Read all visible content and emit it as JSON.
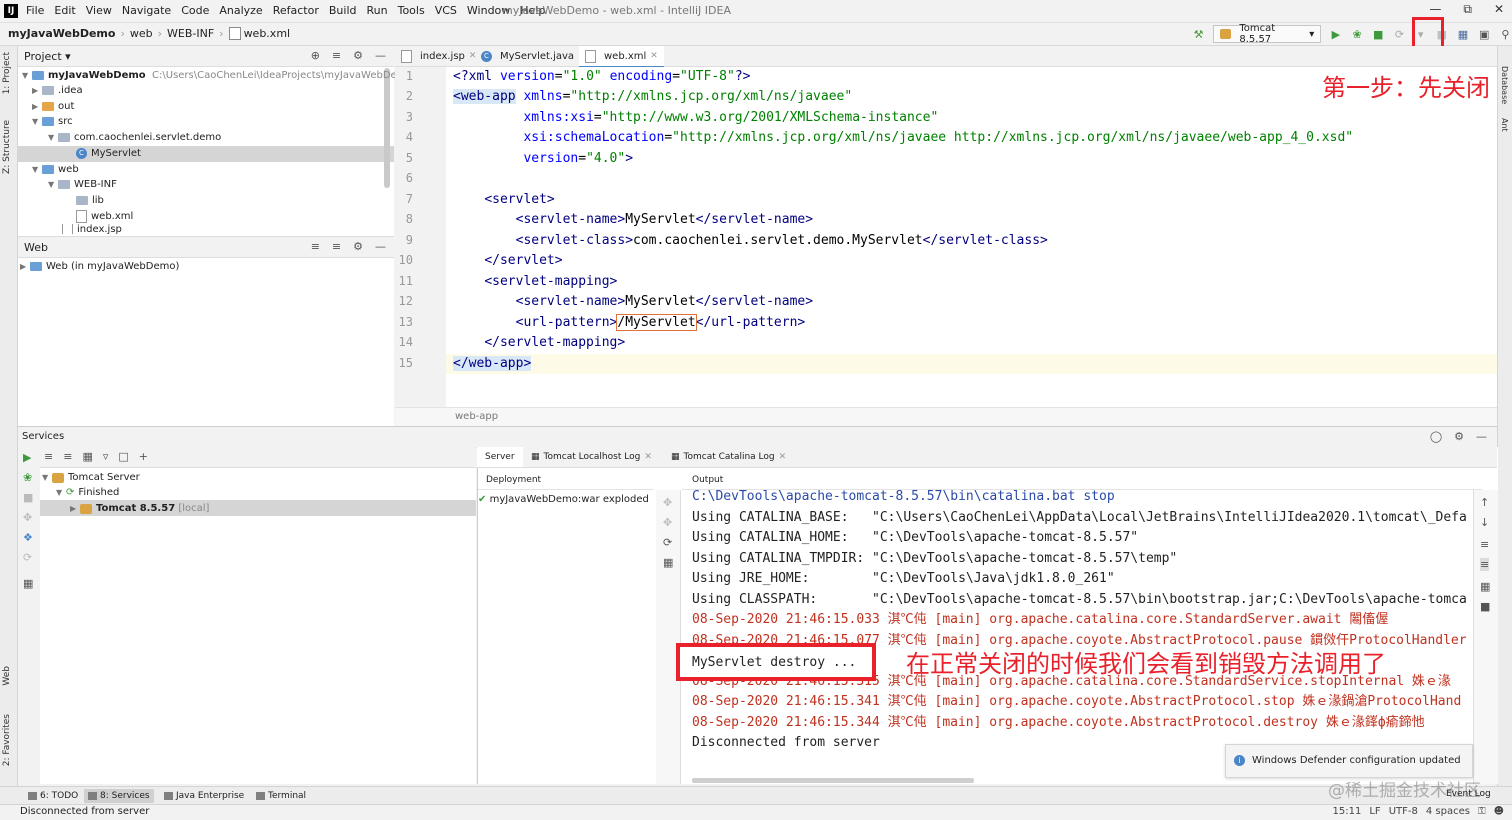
{
  "menu": {
    "items": [
      "File",
      "Edit",
      "View",
      "Navigate",
      "Code",
      "Analyze",
      "Refactor",
      "Build",
      "Run",
      "Tools",
      "VCS",
      "Window",
      "Help"
    ],
    "window_title": "myJavaWebDemo - web.xml - IntelliJ IDEA"
  },
  "breadcrumb": [
    "myJavaWebDemo",
    "web",
    "WEB-INF",
    "web.xml"
  ],
  "run_config": "Tomcat 8.5.57",
  "project_panel": {
    "title": "Project",
    "root_name": "myJavaWebDemo",
    "root_path": "C:\\Users\\CaoChenLei\\IdeaProjects\\myJavaWebDemo",
    "items": [
      ".idea",
      "out",
      "src",
      "com.caochenlei.servlet.demo",
      "MyServlet",
      "web",
      "WEB-INF",
      "lib",
      "web.xml",
      "index.jsp"
    ]
  },
  "web_panel": {
    "title": "Web",
    "item": "Web (in myJavaWebDemo)"
  },
  "left_strip": {
    "project": "1: Project",
    "structure": "Z: Structure",
    "web": "Web",
    "favorites": "2: Favorites"
  },
  "right_strip": {
    "database": "Database",
    "ant": "Ant"
  },
  "editor": {
    "tabs": [
      "index.jsp",
      "MyServlet.java",
      "web.xml"
    ],
    "line_numbers": [
      "1",
      "2",
      "3",
      "4",
      "5",
      "6",
      "7",
      "8",
      "9",
      "10",
      "11",
      "12",
      "13",
      "14",
      "15"
    ],
    "lines": [
      {
        "num": "1",
        "parts": [
          [
            "tag",
            "<?xml "
          ],
          [
            "attr",
            "version"
          ],
          [
            "txt",
            "="
          ],
          [
            "str",
            "\"1.0\""
          ],
          [
            "txt",
            " "
          ],
          [
            "attr",
            "encoding"
          ],
          [
            "txt",
            "="
          ],
          [
            "str",
            "\"UTF-8\""
          ],
          [
            "tag",
            "?>"
          ]
        ]
      },
      {
        "num": "2",
        "parts": [
          [
            "tag hl",
            "<web-app"
          ],
          [
            "txt",
            " "
          ],
          [
            "attr",
            "xmlns"
          ],
          [
            "txt",
            "="
          ],
          [
            "str",
            "\"http://xmlns.jcp.org/xml/ns/javaee\""
          ]
        ]
      },
      {
        "num": "3",
        "parts": [
          [
            "txt",
            "         "
          ],
          [
            "attr",
            "xmlns:xsi"
          ],
          [
            "txt",
            "="
          ],
          [
            "str",
            "\"http://www.w3.org/2001/XMLSchema-instance\""
          ]
        ]
      },
      {
        "num": "4",
        "parts": [
          [
            "txt",
            "         "
          ],
          [
            "attr",
            "xsi:schemaLocation"
          ],
          [
            "txt",
            "="
          ],
          [
            "str",
            "\"http://xmlns.jcp.org/xml/ns/javaee http://xmlns.jcp.org/xml/ns/javaee/web-app_4_0.xsd\""
          ]
        ]
      },
      {
        "num": "5",
        "parts": [
          [
            "txt",
            "         "
          ],
          [
            "attr",
            "version"
          ],
          [
            "txt",
            "="
          ],
          [
            "str",
            "\"4.0\""
          ],
          [
            "tag",
            ">"
          ]
        ]
      },
      {
        "num": "6",
        "parts": []
      },
      {
        "num": "7",
        "parts": [
          [
            "txt",
            "    "
          ],
          [
            "tag",
            "<servlet>"
          ]
        ]
      },
      {
        "num": "8",
        "parts": [
          [
            "txt",
            "        "
          ],
          [
            "tag",
            "<servlet-name>"
          ],
          [
            "txt",
            "MyServlet"
          ],
          [
            "tag",
            "</servlet-name>"
          ]
        ]
      },
      {
        "num": "9",
        "parts": [
          [
            "txt",
            "        "
          ],
          [
            "tag",
            "<servlet-class>"
          ],
          [
            "txt",
            "com.caochenlei.servlet.demo.MyServlet"
          ],
          [
            "tag",
            "</servlet-class>"
          ]
        ]
      },
      {
        "num": "10",
        "parts": [
          [
            "txt",
            "    "
          ],
          [
            "tag",
            "</servlet>"
          ]
        ]
      },
      {
        "num": "11",
        "parts": [
          [
            "txt",
            "    "
          ],
          [
            "tag",
            "<servlet-mapping>"
          ]
        ]
      },
      {
        "num": "12",
        "parts": [
          [
            "txt",
            "        "
          ],
          [
            "tag",
            "<servlet-name>"
          ],
          [
            "txt",
            "MyServlet"
          ],
          [
            "tag",
            "</servlet-name>"
          ]
        ]
      },
      {
        "num": "13",
        "parts": [
          [
            "txt",
            "        "
          ],
          [
            "tag",
            "<url-pattern>"
          ],
          [
            "txt url-hl",
            "/MyServlet"
          ],
          [
            "tag",
            "</url-pattern>"
          ]
        ]
      },
      {
        "num": "14",
        "parts": [
          [
            "txt",
            "    "
          ],
          [
            "tag",
            "</servlet-mapping>"
          ]
        ]
      },
      {
        "num": "15",
        "parts": [
          [
            "tag hl",
            "</web-app>"
          ]
        ]
      }
    ],
    "crumb": "web-app"
  },
  "annotations": {
    "step1": "第一步：先关闭",
    "step2": "在正常关闭的时候我们会看到销毁方法调用了"
  },
  "services": {
    "title": "Services",
    "tree": [
      "Tomcat Server",
      "Finished",
      "Tomcat 8.5.57"
    ],
    "tree_suffix": "[local]",
    "tabs": [
      "Server",
      "Tomcat Localhost Log",
      "Tomcat Catalina Log"
    ],
    "deployment_header": "Deployment",
    "deployment_item": "myJavaWebDemo:war exploded",
    "output_header": "Output",
    "console": [
      {
        "style": "con-blue",
        "text": "C:\\DevTools\\apache-tomcat-8.5.57\\bin\\catalina.bat stop"
      },
      {
        "style": "con-white",
        "text": "Using CATALINA_BASE:   \"C:\\Users\\CaoChenLei\\AppData\\Local\\JetBrains\\IntelliJIdea2020.1\\tomcat\\_Defa"
      },
      {
        "style": "con-white",
        "text": "Using CATALINA_HOME:   \"C:\\DevTools\\apache-tomcat-8.5.57\""
      },
      {
        "style": "con-white",
        "text": "Using CATALINA_TMPDIR: \"C:\\DevTools\\apache-tomcat-8.5.57\\temp\""
      },
      {
        "style": "con-white",
        "text": "Using JRE_HOME:        \"C:\\DevTools\\Java\\jdk1.8.0_261\""
      },
      {
        "style": "con-white",
        "text": "Using CLASSPATH:       \"C:\\DevTools\\apache-tomcat-8.5.57\\bin\\bootstrap.jar;C:\\DevTools\\apache-tomca"
      },
      {
        "style": "con-red",
        "text": "08-Sep-2020 21:46:15.033 淇℃伅 [main] org.apache.catalina.core.StandardServer.await 闂傗偓"
      },
      {
        "style": "con-red",
        "text": "08-Sep-2020 21:46:15.077 淇℃伅 [main] org.apache.coyote.AbstractProtocol.pause 鏆傚仠ProtocolHandler"
      },
      {
        "style": "con-white",
        "text": ""
      },
      {
        "style": "con-red",
        "text": "08-Sep-2020 21:46:15.315 淇℃伅 [main] org.apache.catalina.core.StandardService.stopInternal 姝ｅ湪"
      },
      {
        "style": "con-red",
        "text": "08-Sep-2020 21:46:15.341 淇℃伅 [main] org.apache.coyote.AbstractProtocol.stop 姝ｅ湪鍋滄ProtocolHand"
      },
      {
        "style": "con-red",
        "text": "08-Sep-2020 21:46:15.344 淇℃伅 [main] org.apache.coyote.AbstractProtocol.destroy 姝ｅ湪鎽ф瘉鍗忚"
      },
      {
        "style": "con-white",
        "text": "Disconnected from server"
      }
    ],
    "destroy_line": "MyServlet destroy ...",
    "notification": "Windows Defender configuration updated"
  },
  "bottom_bar": [
    "6: TODO",
    "8: Services",
    "Java Enterprise",
    "Terminal"
  ],
  "event_log": "Event Log",
  "watermark": "@稀土掘金技术社区",
  "status": {
    "text": "Disconnected from server",
    "position": "15:11",
    "line_sep": "LF",
    "encoding": "UTF-8",
    "indent": "4 spaces"
  },
  "colors": {
    "annotation_red": "#e8212b",
    "accent": "#4a88c7"
  }
}
